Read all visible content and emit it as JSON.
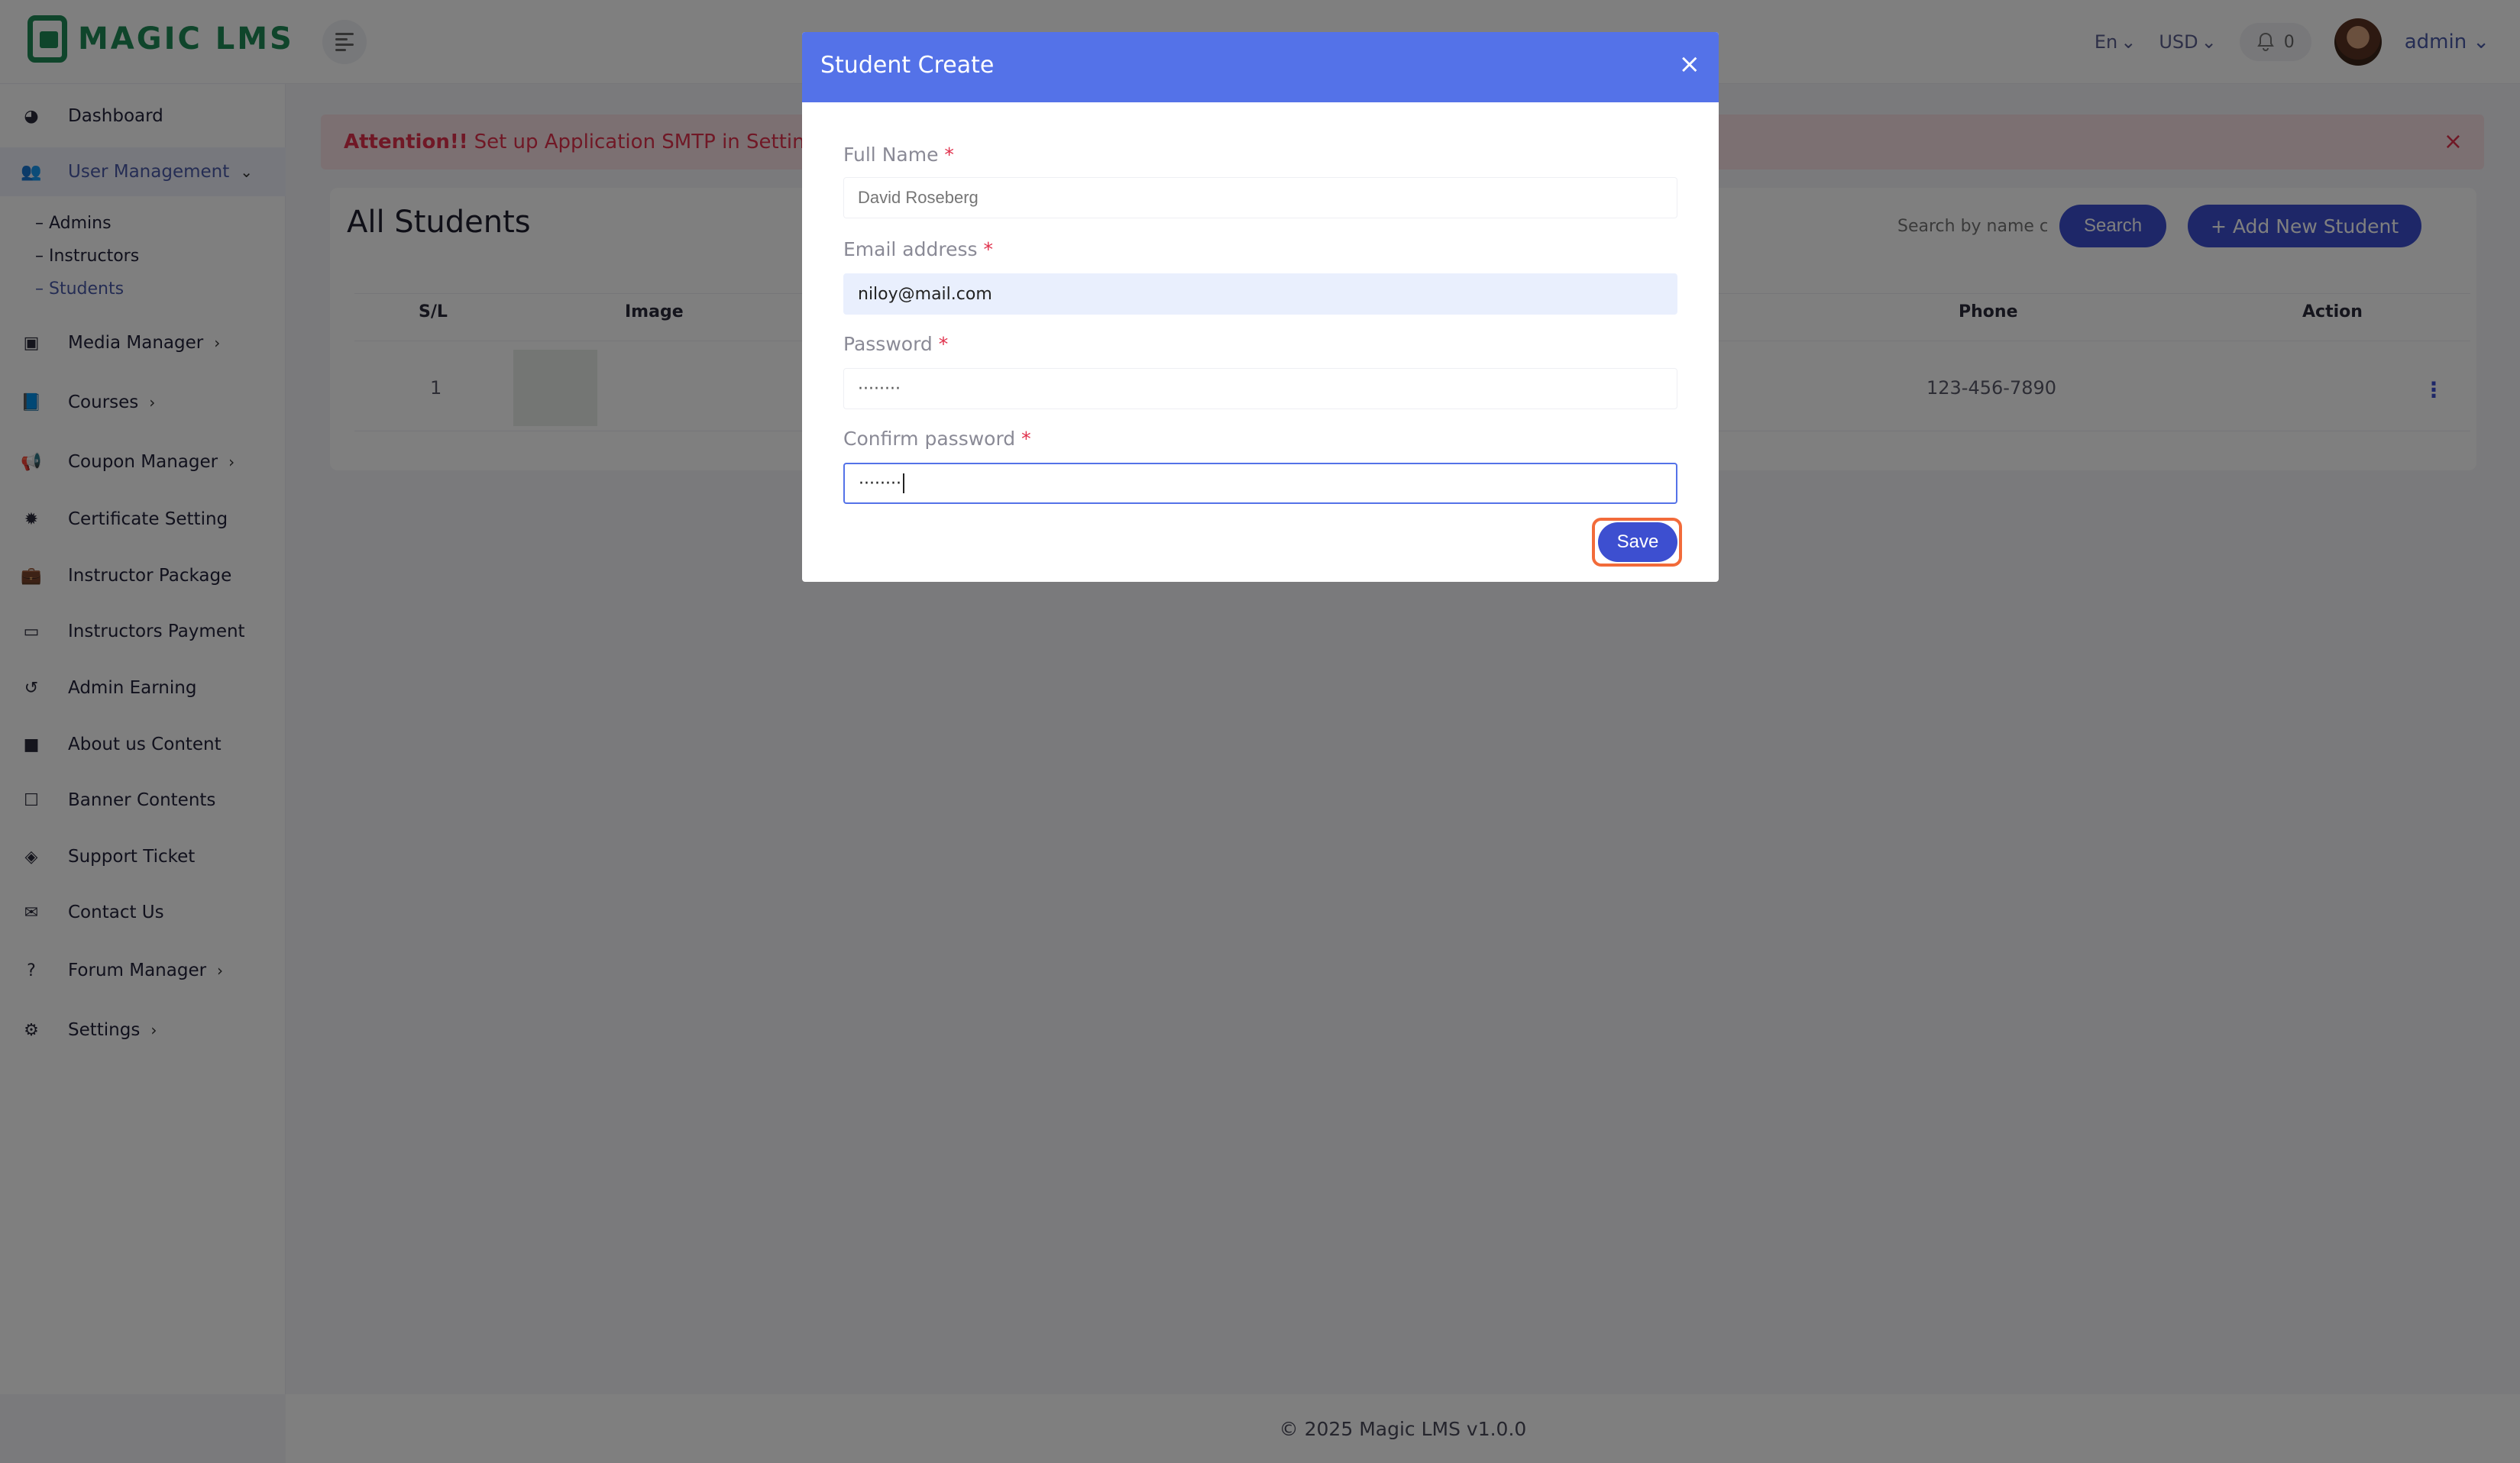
{
  "app": {
    "logo_text": "MAGIC LMS"
  },
  "header": {
    "language": "En",
    "currency": "USD",
    "notifications": "0",
    "user": "admin"
  },
  "sidebar": {
    "items": [
      {
        "label": "Dashboard",
        "icon": "dashboard-icon"
      },
      {
        "label": "User Management",
        "icon": "users-icon"
      },
      {
        "label": "Media Manager",
        "icon": "image-icon"
      },
      {
        "label": "Courses",
        "icon": "book-icon"
      },
      {
        "label": "Coupon Manager",
        "icon": "megaphone-icon"
      },
      {
        "label": "Certificate Setting",
        "icon": "certificate-icon"
      },
      {
        "label": "Instructor Package",
        "icon": "briefcase-icon"
      },
      {
        "label": "Instructors Payment",
        "icon": "money-icon"
      },
      {
        "label": "Admin Earning",
        "icon": "history-icon"
      },
      {
        "label": "About us Content",
        "icon": "file-icon"
      },
      {
        "label": "Banner Contents",
        "icon": "note-icon"
      },
      {
        "label": "Support Ticket",
        "icon": "ticket-icon"
      },
      {
        "label": "Contact Us",
        "icon": "envelope-icon"
      },
      {
        "label": "Forum Manager",
        "icon": "question-icon"
      },
      {
        "label": "Settings",
        "icon": "gear-icon"
      }
    ],
    "sub_items": [
      "– Admins",
      "– Instructors",
      "– Students"
    ]
  },
  "alert": {
    "strong": "Attention!!",
    "text": "Set up Application SMTP in Settings fo"
  },
  "main": {
    "title": "All Students",
    "search_placeholder": "Search by name c",
    "search_button": "Search",
    "add_button": "+ Add New Student",
    "columns": [
      "S/L",
      "Image",
      "Phone",
      "Action"
    ],
    "rows": [
      {
        "sl": "1",
        "phone": "123-456-7890"
      }
    ]
  },
  "footer": {
    "text": "© 2025 Magic LMS v1.0.0"
  },
  "modal": {
    "title": "Student Create",
    "fields": [
      {
        "label": "Full Name",
        "value": "",
        "placeholder": "David Roseberg"
      },
      {
        "label": "Email address",
        "value": "niloy@mail.com"
      },
      {
        "label": "Password",
        "value": "········"
      },
      {
        "label": "Confirm password",
        "value": "········"
      }
    ],
    "required_mark": "*",
    "save_button": "Save"
  },
  "colors": {
    "primary": "#3d4fd0",
    "modal_header": "#5472e8",
    "brand_green": "#1f8a57",
    "alert_red": "#e0314c"
  }
}
